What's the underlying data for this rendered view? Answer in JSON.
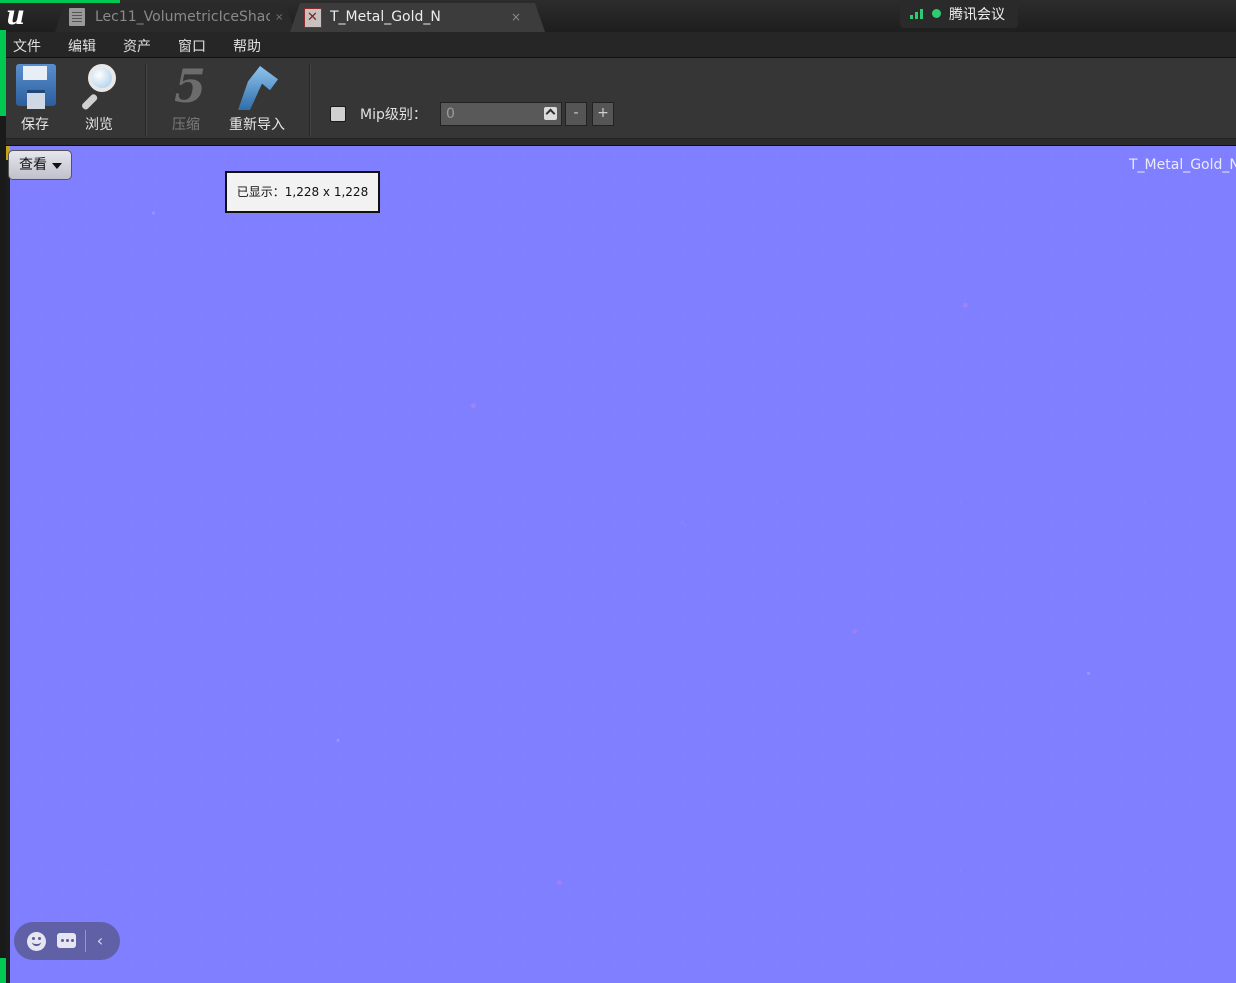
{
  "tabs": [
    {
      "label": "Lec11_VolumetricIceShac",
      "close": "×"
    },
    {
      "label": "T_Metal_Gold_N",
      "close": "×"
    }
  ],
  "meeting": {
    "label": "腾讯会议"
  },
  "menu": {
    "items": [
      "文件",
      "编辑",
      "资产",
      "窗口",
      "帮助"
    ]
  },
  "toolbar": {
    "save_label": "保存",
    "browse_label": "浏览",
    "compress_label": "压缩",
    "reimport_label": "重新导入",
    "mip_label": "Mip级别：",
    "mip_value": "0",
    "minus": "-",
    "plus": "+"
  },
  "viewport": {
    "view_button": "查看",
    "displayed_info": "已显示：1,228 x 1,228",
    "texture_name": "T_Metal_Gold_N",
    "background_color": "#7f7fff"
  },
  "float_bar": {
    "collapse": "‹"
  }
}
